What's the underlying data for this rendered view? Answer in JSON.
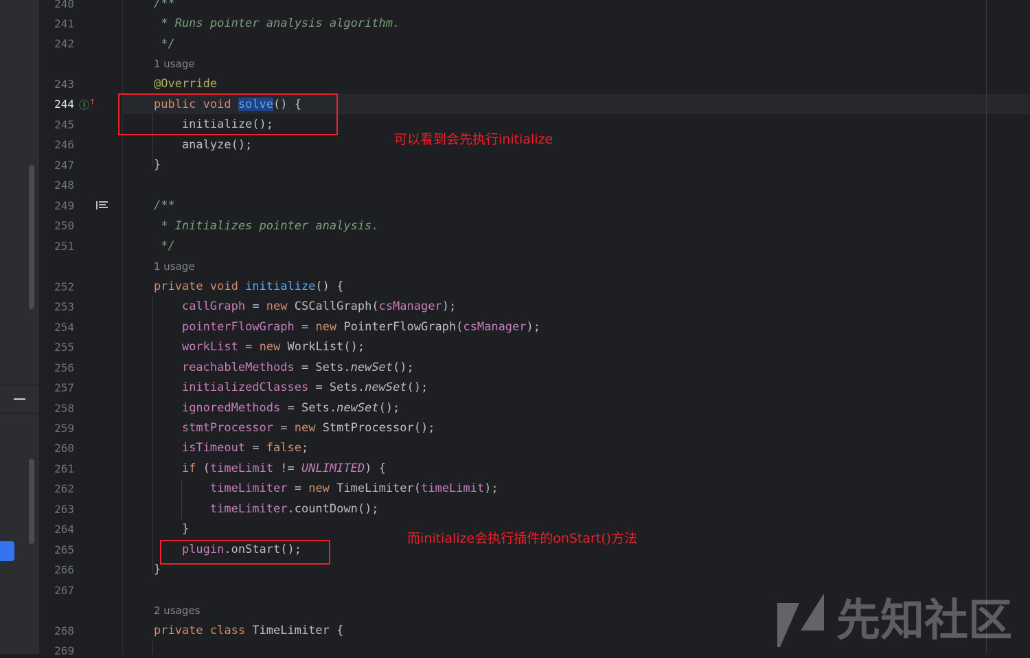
{
  "colors": {
    "background": "#1e1f22",
    "keyword": "#cf8e6d",
    "method": "#56a8f5",
    "field": "#c77dbb",
    "comment": "#7a9e7e",
    "annotation": "#b3ae60",
    "annotation_red": "#f0202a"
  },
  "icons": {
    "override": "override-up-arrow-icon",
    "reader_mode": "reader-mode-icon",
    "collapse": "minus-icon"
  },
  "gutter": {
    "line_numbers": [
      "240",
      "241",
      "242",
      "243",
      "244",
      "245",
      "246",
      "247",
      "248",
      "249",
      "250",
      "251",
      "252",
      "253",
      "254",
      "255",
      "256",
      "257",
      "258",
      "259",
      "260",
      "261",
      "262",
      "263",
      "264",
      "265",
      "266",
      "267",
      "268",
      "269"
    ],
    "current_line": "244"
  },
  "code": {
    "l240": "/**",
    "l241": " * Runs pointer analysis algorithm.",
    "l242": " */",
    "usage1": "1 usage",
    "l243": "@Override",
    "l244_kw": "public void ",
    "l244_fn": "solve",
    "l244_rest": "() {",
    "l245": "    initialize();",
    "l246": "    analyze();",
    "l247": "}",
    "l249": "/**",
    "l250": " * Initializes pointer analysis.",
    "l251": " */",
    "usage2": "1 usage",
    "l252_kw": "private void ",
    "l252_fn": "initialize",
    "l252_rest": "() {",
    "l253_f": "callGraph",
    "l253_m": " = ",
    "l253_kw": "new",
    "l253_t": " CSCallGraph(",
    "l253_f2": "csManager",
    "l253_e": ");",
    "l254_f": "pointerFlowGraph",
    "l254_m": " = ",
    "l254_kw": "new",
    "l254_t": " PointerFlowGraph(",
    "l254_f2": "csManager",
    "l254_e": ");",
    "l255_f": "workList",
    "l255_m": " = ",
    "l255_kw": "new",
    "l255_t": " WorkList();",
    "l256_f": "reachableMethods",
    "l256_m": " = Sets.",
    "l256_i": "newSet",
    "l256_e": "();",
    "l257_f": "initializedClasses",
    "l257_m": " = Sets.",
    "l257_i": "newSet",
    "l257_e": "();",
    "l258_f": "ignoredMethods",
    "l258_m": " = Sets.",
    "l258_i": "newSet",
    "l258_e": "();",
    "l259_f": "stmtProcessor",
    "l259_m": " = ",
    "l259_kw": "new",
    "l259_t": " StmtProcessor();",
    "l260_f": "isTimeout",
    "l260_m": " = ",
    "l260_kw": "false",
    "l260_e": ";",
    "l261_kw": "if",
    "l261_a": " (",
    "l261_f": "timeLimit",
    "l261_m": " != ",
    "l261_c": "UNLIMITED",
    "l261_e": ") {",
    "l262_f": "timeLimiter",
    "l262_m": " = ",
    "l262_kw": "new",
    "l262_t": " TimeLimiter(",
    "l262_f2": "timeLimit",
    "l262_e": ");",
    "l263_f": "timeLimiter",
    "l263_e": ".countDown();",
    "l264": "}",
    "l265_f": "plugin",
    "l265_e": ".onStart();",
    "l266": "}",
    "usage3": "2 usages",
    "l268_kw": "private class ",
    "l268_t": "TimeLimiter {"
  },
  "annotations": {
    "note1": "可以看到会先执行initialize",
    "note2": "而initialize会执行插件的onStart()方法"
  },
  "watermark": {
    "text": "先知社区"
  }
}
